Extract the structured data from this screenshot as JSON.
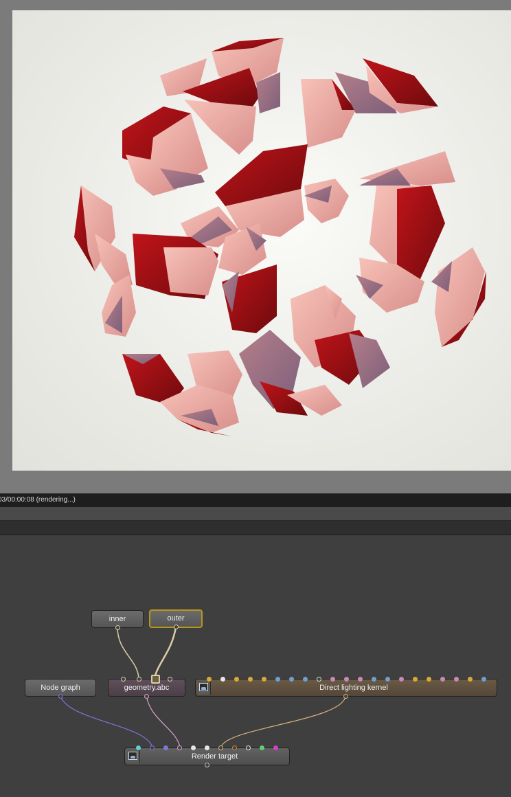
{
  "status": {
    "text": "03/00:00:08 (rendering...)"
  },
  "nodes": {
    "inner": "inner",
    "outer": "outer",
    "node_graph": "Node graph",
    "geometry": "geometry.abc",
    "kernel": "Direct lighting kernel",
    "render_target": "Render target"
  },
  "icons": {
    "kernel_icon": "kernel-node-icon",
    "render_icon": "render-target-icon"
  },
  "colors": {
    "selected_outline": "#b8961e",
    "wire_inner_outer": "#d9ceaa",
    "wire_node_graph": "#7a78d8",
    "wire_geometry": "#d7a6c6",
    "wire_kernel": "#d6b27a",
    "render_shard_dark": "#7a0c10",
    "render_shard_light": "#f5b5ad"
  }
}
